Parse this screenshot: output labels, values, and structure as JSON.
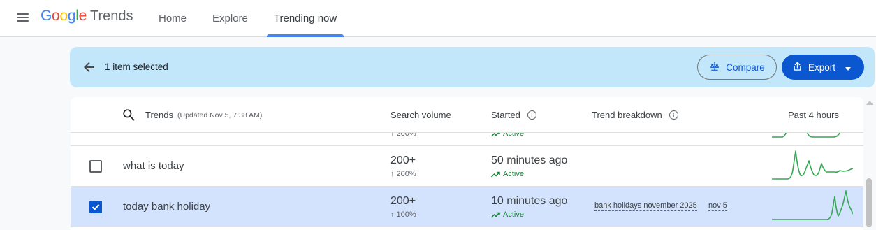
{
  "app": {
    "logo_word": "Google",
    "logo_product": "Trends",
    "nav": [
      {
        "label": "Home",
        "active": false
      },
      {
        "label": "Explore",
        "active": false
      },
      {
        "label": "Trending now",
        "active": true
      }
    ]
  },
  "selection_bar": {
    "text": "1 item selected",
    "compare_label": "Compare",
    "export_label": "Export"
  },
  "table": {
    "headers": {
      "trends": "Trends",
      "updated": "(Updated Nov 5, 7:38 AM)",
      "search_volume": "Search volume",
      "started": "Started",
      "breakdown": "Trend breakdown",
      "activity": "Past 4 hours"
    },
    "rows": [
      {
        "name": "",
        "volume": "",
        "change": "↑ 200%",
        "started": "",
        "status": "Active",
        "checked": false,
        "breakdown": []
      },
      {
        "name": "what is today",
        "volume": "200+",
        "change": "↑ 200%",
        "started": "50 minutes ago",
        "status": "Active",
        "checked": false,
        "breakdown": []
      },
      {
        "name": "today bank holiday",
        "volume": "200+",
        "change": "↑ 100%",
        "started": "10 minutes ago",
        "status": "Active",
        "checked": true,
        "breakdown": [
          "bank holidays november 2025",
          "nov 5"
        ]
      }
    ]
  },
  "colors": {
    "accent": "#0b57d0",
    "selection_bar": "#c2e7fb",
    "selected_row": "#d3e3fd",
    "active_green": "#188038",
    "spark_green": "#34a853"
  }
}
